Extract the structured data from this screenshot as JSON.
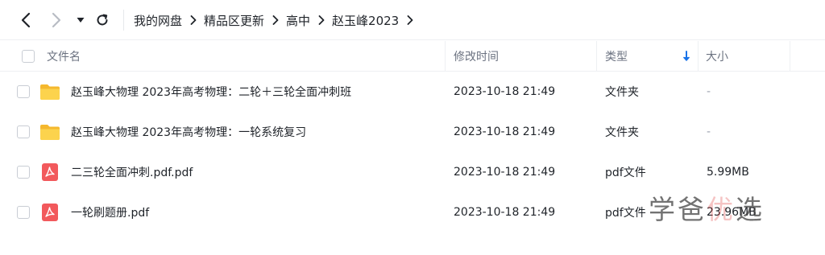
{
  "navigation": {
    "back_icon": "chevron-left-icon",
    "forward_icon": "chevron-right-icon",
    "history_icon": "caret-down-icon",
    "refresh_icon": "refresh-icon"
  },
  "breadcrumb": {
    "items": [
      "我的网盘",
      "精品区更新",
      "高中",
      "赵玉峰2023"
    ],
    "separator_icon": "chevron-right-icon"
  },
  "columns": {
    "name": "文件名",
    "modified": "修改时间",
    "type": "类型",
    "size": "大小",
    "sort_icon": "arrow-down-icon",
    "sort_color": "#1a73e8"
  },
  "files": [
    {
      "name": "赵玉峰大物理 2023年高考物理：二轮＋三轮全面冲刺班",
      "modified": "2023-10-18 21:49",
      "type": "文件夹",
      "size": "-",
      "icon": "folder-icon"
    },
    {
      "name": "赵玉峰大物理 2023年高考物理：一轮系统复习",
      "modified": "2023-10-18 21:49",
      "type": "文件夹",
      "size": "-",
      "icon": "folder-icon"
    },
    {
      "name": "二三轮全面冲刺.pdf.pdf",
      "modified": "2023-10-18 21:49",
      "type": "pdf文件",
      "size": "5.99MB",
      "icon": "pdf-icon"
    },
    {
      "name": "一轮刷题册.pdf",
      "modified": "2023-10-18 21:49",
      "type": "pdf文件",
      "size": "23.96MB",
      "icon": "pdf-icon"
    }
  ],
  "colors": {
    "folder": "#f9c534",
    "pdf": "#f2595c"
  },
  "watermark": {
    "part1": "学爸",
    "part2": "优",
    "part3": "选"
  }
}
